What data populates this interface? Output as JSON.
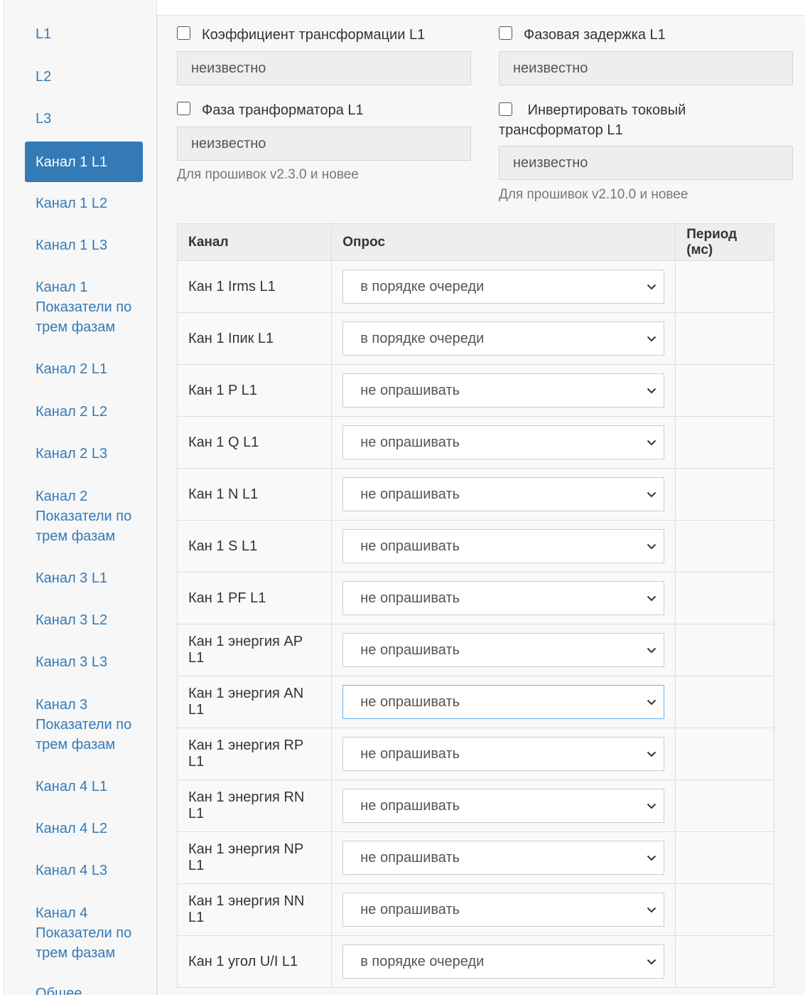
{
  "sidebar": {
    "items": [
      {
        "label": "L1"
      },
      {
        "label": "L2"
      },
      {
        "label": "L3"
      },
      {
        "label": "Канал 1 L1",
        "active": true
      },
      {
        "label": "Канал 1 L2"
      },
      {
        "label": "Канал 1 L3"
      },
      {
        "label": "Канал 1 Показатели по трем фазам"
      },
      {
        "label": "Канал 2 L1"
      },
      {
        "label": "Канал 2 L2"
      },
      {
        "label": "Канал 2 L3"
      },
      {
        "label": "Канал 2 Показатели по трем фазам"
      },
      {
        "label": "Канал 3 L1"
      },
      {
        "label": "Канал 3 L2"
      },
      {
        "label": "Канал 3 L3"
      },
      {
        "label": "Канал 3 Показатели по трем фазам"
      },
      {
        "label": "Канал 4 L1"
      },
      {
        "label": "Канал 4 L2"
      },
      {
        "label": "Канал 4 L3"
      },
      {
        "label": "Канал 4 Показатели по трем фазам"
      },
      {
        "label": "Общее"
      }
    ]
  },
  "settings": {
    "ratio": {
      "label": "Коэффициент трансформации L1",
      "value": "неизвестно"
    },
    "delay": {
      "label": "Фазовая задержка L1",
      "value": "неизвестно"
    },
    "phase": {
      "label": "Фаза транформатора L1",
      "value": "неизвестно",
      "hint": "Для прошивок v2.3.0 и новее"
    },
    "invert": {
      "label": "Инвертировать токовый трансформатор L1",
      "value": "неизвестно",
      "hint": "Для прошивок v2.10.0 и новее"
    }
  },
  "table": {
    "headers": {
      "channel": "Канал",
      "poll": "Опрос",
      "period": "Период (мс)"
    },
    "rows": [
      {
        "channel": "Кан 1 Irms L1",
        "poll": "в порядке очереди"
      },
      {
        "channel": "Кан 1 Iпик L1",
        "poll": "в порядке очереди"
      },
      {
        "channel": "Кан 1 P L1",
        "poll": "не опрашивать"
      },
      {
        "channel": "Кан 1 Q L1",
        "poll": "не опрашивать"
      },
      {
        "channel": "Кан 1 N L1",
        "poll": "не опрашивать"
      },
      {
        "channel": "Кан 1 S L1",
        "poll": "не опрашивать"
      },
      {
        "channel": "Кан 1 PF L1",
        "poll": "не опрашивать"
      },
      {
        "channel": "Кан 1 энергия AP L1",
        "poll": "не опрашивать"
      },
      {
        "channel": "Кан 1 энергия AN L1",
        "poll": "не опрашивать",
        "focused": true
      },
      {
        "channel": "Кан 1 энергия RP L1",
        "poll": "не опрашивать"
      },
      {
        "channel": "Кан 1 энергия RN L1",
        "poll": "не опрашивать"
      },
      {
        "channel": "Кан 1 энергия NP L1",
        "poll": "не опрашивать"
      },
      {
        "channel": "Кан 1 энергия NN L1",
        "poll": "не опрашивать"
      },
      {
        "channel": "Кан 1 угол U/I L1",
        "poll": "в порядке очереди"
      }
    ]
  },
  "colors": {
    "accent": "#337ab7",
    "link": "#337ab7",
    "focus": "#66afe9"
  }
}
